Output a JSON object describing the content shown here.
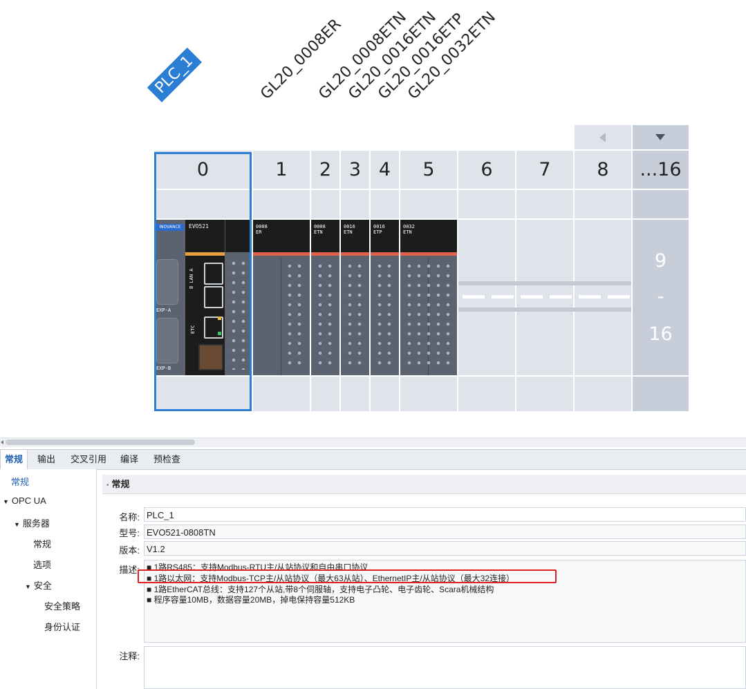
{
  "diagram": {
    "plc_badge": "PLC_1",
    "device_labels": [
      "GL20_0008ER",
      "GL20_0008ETN",
      "GL20_0016ETN",
      "GL20_0016ETP",
      "GL20_0032ETN"
    ],
    "slots": [
      "0",
      "1",
      "2",
      "3",
      "4",
      "5",
      "6",
      "7",
      "8",
      "...16"
    ],
    "range_top": "9",
    "range_sep": "-",
    "range_bottom": "16",
    "cpu": {
      "brand": "INOVANCE",
      "model": "EVO521",
      "port_exp_a": "EXP-A",
      "port_exp_b": "EXP-B",
      "port_lan": "B LAN A",
      "port_etc": "ETC"
    },
    "module_heads": [
      [
        "0008",
        "ER"
      ],
      [
        "0008",
        "ETN"
      ],
      [
        "0016",
        "ETN"
      ],
      [
        "0016",
        "ETP"
      ],
      [
        "0032",
        "ETN"
      ]
    ],
    "prev_icon": "triangle-left-icon",
    "down_icon": "triangle-down-icon"
  },
  "tabs": [
    "常规",
    "输出",
    "交叉引用",
    "编译",
    "预检查"
  ],
  "sidebar": {
    "items": [
      "常规",
      "OPC UA",
      "服务器",
      "常规",
      "选项",
      "安全",
      "安全策略",
      "身份认证"
    ]
  },
  "main": {
    "section_title": "常规",
    "name_label": "名称:",
    "name_value": "PLC_1",
    "model_label": "型号:",
    "model_value": "EVO521-0808TN",
    "version_label": "版本:",
    "version_value": "V1.2",
    "desc_label": "描述:",
    "desc_lines": [
      "■ 1路RS485：支持Modbus-RTU主/从站协议和自由串口协议",
      "■ 1路以太网：支持Modbus-TCP主/从站协议（最大63从站）、EthernetIP主/从站协议（最大32连接）",
      "■ 1路EtherCAT总线：支持127个从站,带8个伺服轴，支持电子凸轮、电子齿轮、Scara机械结构",
      "■ 程序容量10MB，数据容量20MB，掉电保持容量512KB"
    ],
    "note_label": "注释:"
  },
  "colors": {
    "accent": "#2a7fd4",
    "highlight": "#e02020"
  }
}
